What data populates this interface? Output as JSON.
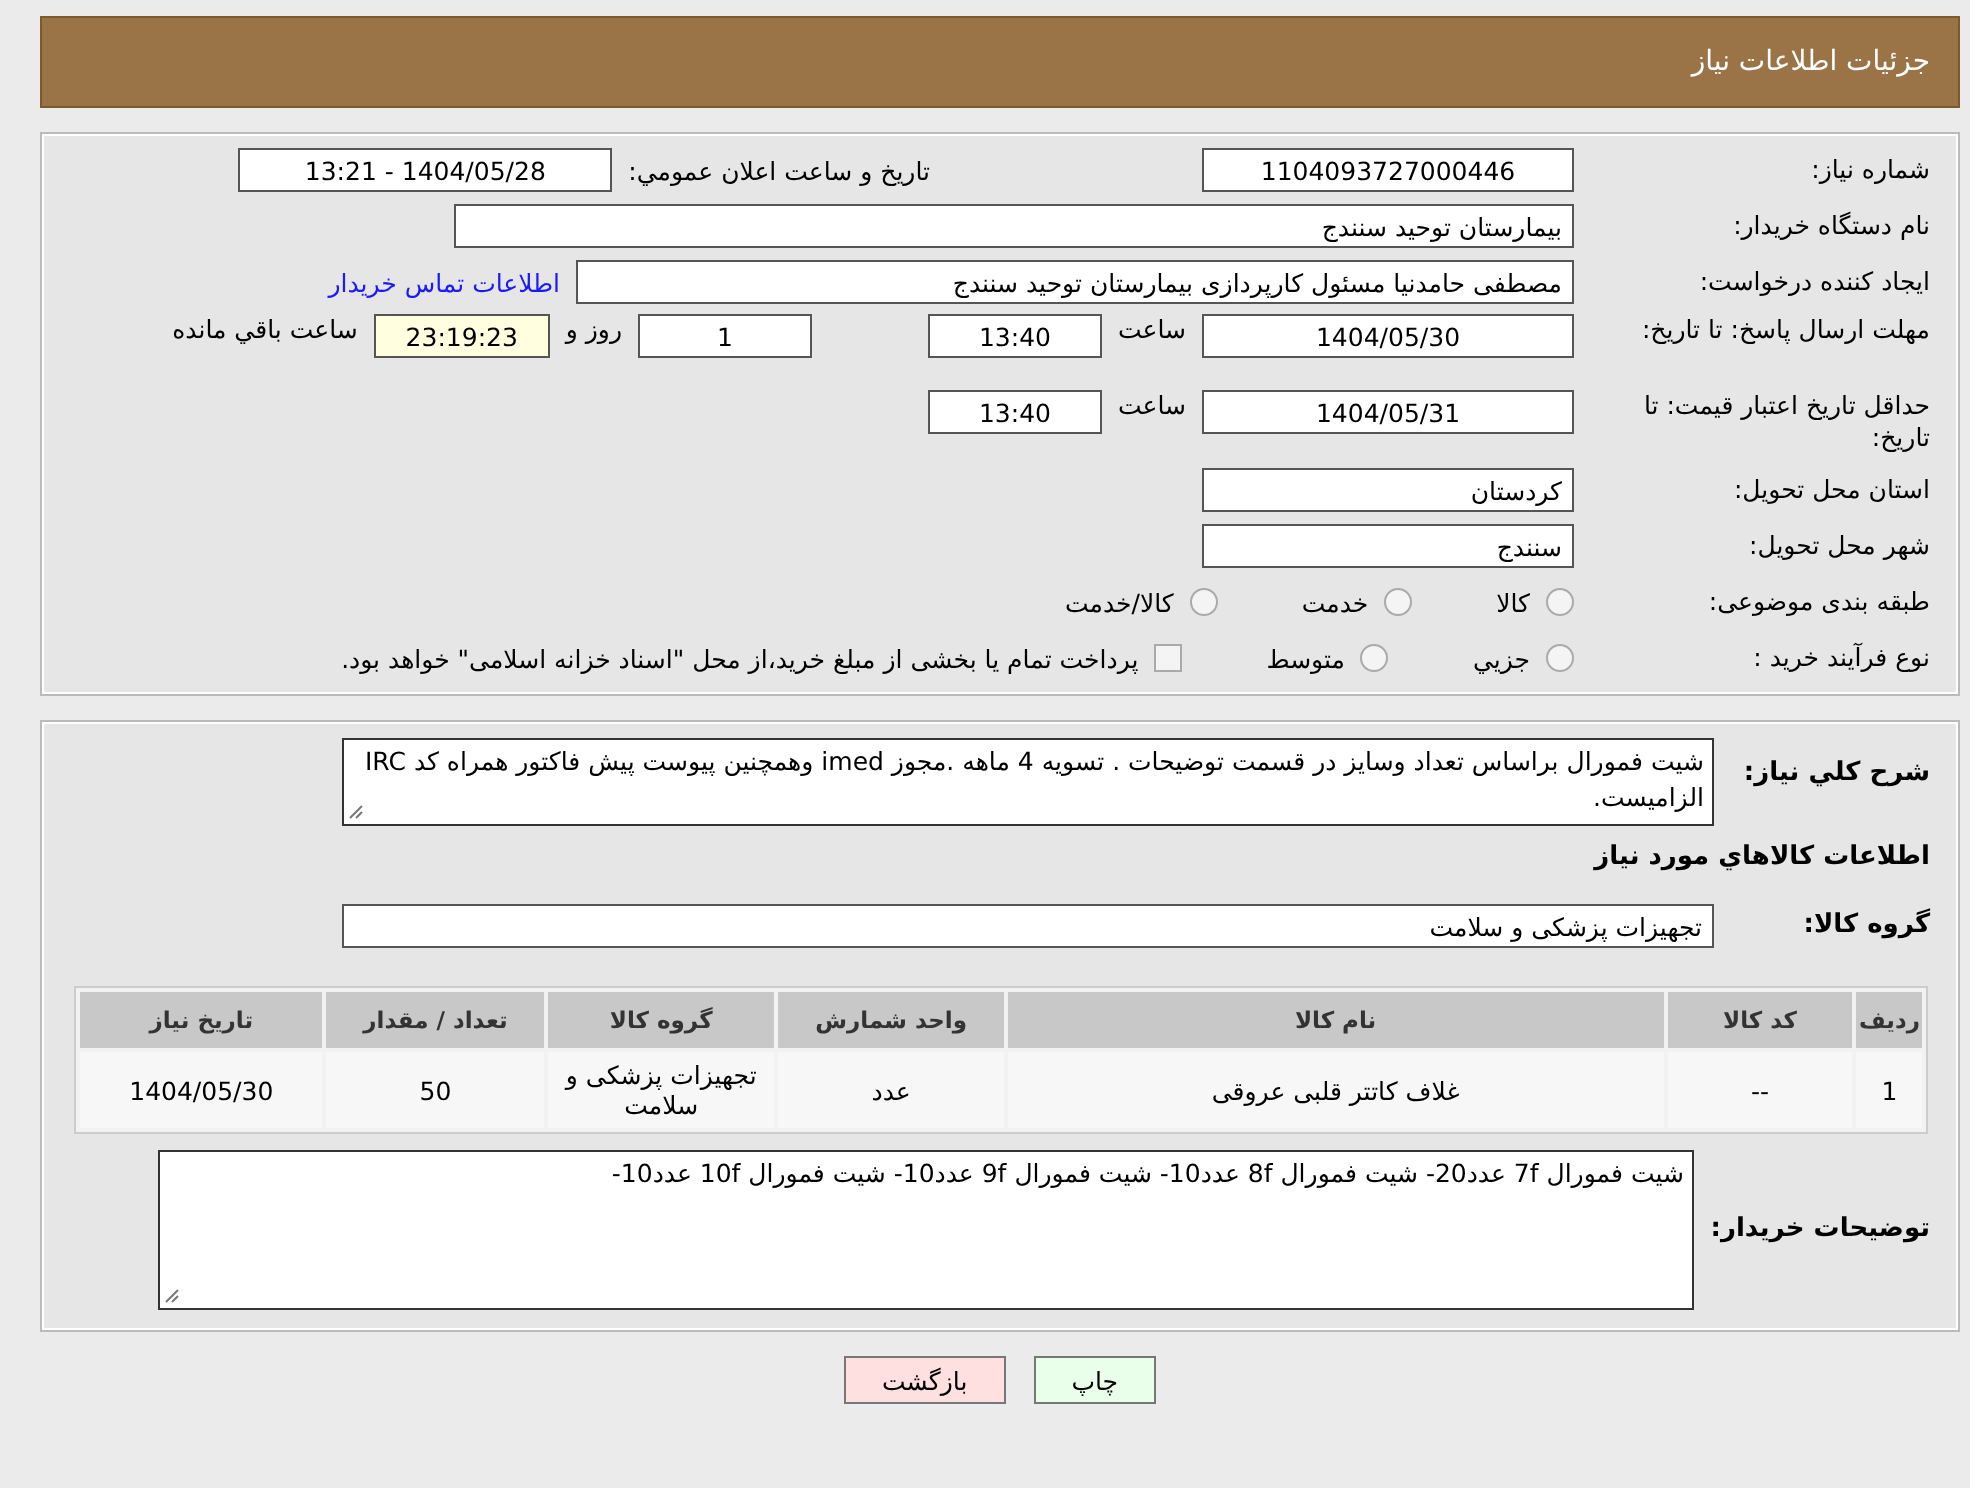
{
  "page_title": "جزئیات اطلاعات نیاز",
  "need_number": {
    "label": "شماره نياز:",
    "value": "1104093727000446"
  },
  "announce": {
    "label": "تاريخ و ساعت اعلان عمومي:",
    "value": "1404/05/28 - 13:21"
  },
  "buyer": {
    "label": "نام دستگاه خريدار:",
    "value": "بیمارستان توحید سنندج"
  },
  "creator": {
    "label": "ايجاد كننده درخواست:",
    "value": "مصطفی حامدنیا مسئول کارپردازی بیمارستان توحید سنندج",
    "link": "اطلاعات تماس خريدار"
  },
  "reply_deadline": {
    "label": "مهلت ارسال پاسخ: تا تاريخ:",
    "date": "1404/05/30",
    "time_label": "ساعت",
    "time": "13:40",
    "days": "1",
    "days_label": "روز و",
    "remaining": "23:19:23",
    "remaining_label": "ساعت باقي مانده"
  },
  "price_validity": {
    "label": "حداقل تاريخ اعتبار قيمت: تا تاريخ:",
    "date": "1404/05/31",
    "time_label": "ساعت",
    "time": "13:40"
  },
  "province": {
    "label": "استان محل تحويل:",
    "value": "کردستان"
  },
  "city": {
    "label": "شهر محل تحويل:",
    "value": "سنندج"
  },
  "category": {
    "label": "طبقه بندی موضوعی:",
    "options": [
      {
        "label": "كالا",
        "selected": false
      },
      {
        "label": "خدمت",
        "selected": false
      },
      {
        "label": "كالا/خدمت",
        "selected": false
      }
    ]
  },
  "process": {
    "label": "نوع فرآيند خريد :",
    "options": [
      {
        "label": "جزيي",
        "selected": false
      },
      {
        "label": "متوسط",
        "selected": false
      }
    ],
    "payment": {
      "label": "پرداخت تمام يا بخشی از مبلغ خريد،از محل \"اسناد خزانه اسلامی\" خواهد بود.",
      "checked": false
    }
  },
  "description": {
    "label": "شرح كلي نياز:",
    "text": "شیت فمورال براساس تعداد وسایز  در قسمت توضیحات . تسویه 4 ماهه .مجوز imed وهمچنین پیوست پیش فاکتور همراه کد IRC  الزامیست."
  },
  "items_heading": "اطلاعات كالاهاي مورد نياز",
  "group": {
    "label": "گروه كالا:",
    "value": "تجهیزات پزشکی و سلامت"
  },
  "table": {
    "columns": [
      "رديف",
      "كد كالا",
      "نام كالا",
      "واحد شمارش",
      "گروه كالا",
      "تعداد / مقدار",
      "تاريخ نياز"
    ],
    "rows": [
      [
        "1",
        "--",
        "غلاف کاتتر قلبی عروقی",
        "عدد",
        "تجهیزات پزشکی و سلامت",
        "50",
        "1404/05/30"
      ]
    ]
  },
  "notes": {
    "label": "توضيحات خريدار:",
    "text": "شیت فمورال 7f  عدد20- شیت فمورال 8f  عدد10- شیت فمورال 9f  عدد10-  شیت فمورال 10f  عدد10-"
  },
  "buttons": [
    {
      "label": "چاپ",
      "kind": "print"
    },
    {
      "label": "بازگشت",
      "kind": "back"
    }
  ]
}
